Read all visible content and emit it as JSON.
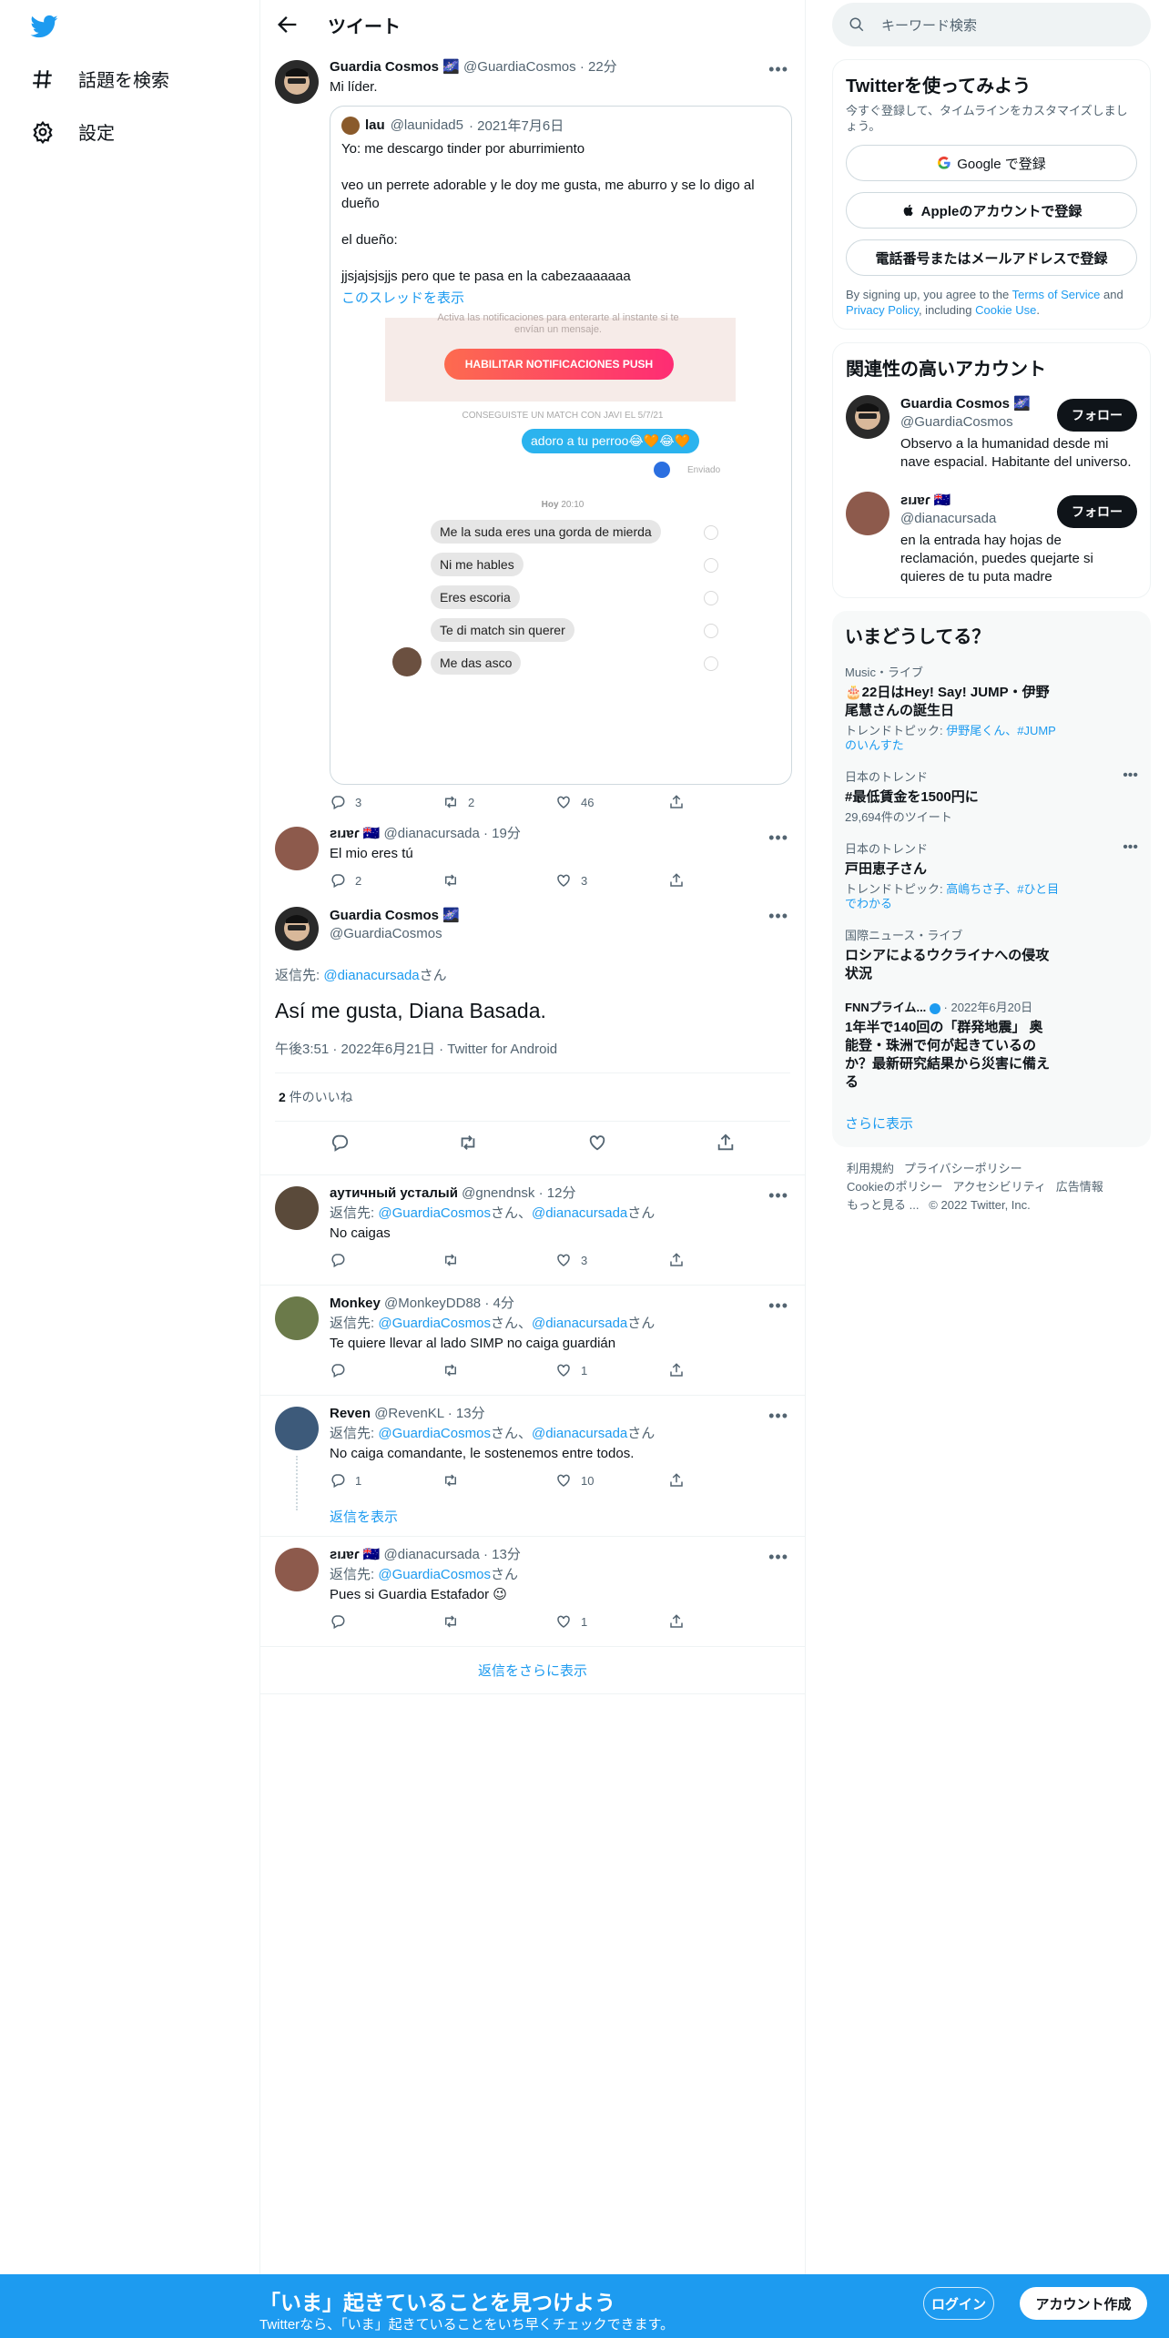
{
  "nav": {
    "explore": "話題を検索",
    "settings": "設定"
  },
  "header": {
    "title": "ツイート"
  },
  "main_tweet": {
    "name": "Guardia Cosmos 🌌",
    "handle": "@GuardiaCosmos",
    "time": "· 22分",
    "text": "Mi líder.",
    "quote": {
      "name": "lau",
      "handle": "@launidad5",
      "date": "· 2021年7月6日",
      "text": "Yo: me descargo tinder por aburrimiento\n\nveo un perrete adorable y le doy me gusta, me aburro y se lo digo al dueño\n\nel dueño:\n\njjsjajsjsjjs pero que te pasa en la cabezaaaaaaa",
      "thread_link": "このスレッドを表示",
      "image": {
        "notif_text": "Activa las notificaciones para enterarte al instante si te envían un mensaje.",
        "notif_button": "HABILITAR NOTIFICACIONES PUSH",
        "match_text": "CONSEGUISTE UN MATCH CON JAVI EL 5/7/21",
        "my_msg": "adoro a tu perroo😂🧡😂🧡",
        "sent": "Enviado",
        "day_label": "Hoy",
        "day_time": "20:10",
        "msgs": [
          "Me la suda eres una gorda de mierda",
          "Ni me hables",
          "Eres escoria",
          "Te di match sin querer",
          "Me das asco"
        ]
      }
    },
    "replies": "3",
    "retweets": "2",
    "likes": "46"
  },
  "reply1": {
    "name": "ƨıɹɐɾ 🇦🇺",
    "handle": "@dianacursada",
    "time": "· 19分",
    "text": "El mio eres tú",
    "replies": "2",
    "retweets": "",
    "likes": "3"
  },
  "focal": {
    "name": "Guardia Cosmos 🌌",
    "handle": "@GuardiaCosmos",
    "reply_to_prefix": "返信先: ",
    "reply_to": "@dianacursada",
    "reply_to_suffix": "さん",
    "text": "Así me gusta, Diana Basada.",
    "meta": "午後3:51 · 2022年6月21日 · Twitter for Android",
    "likes_count": "2",
    "likes_label": " 件のいいね"
  },
  "replies": [
    {
      "name": "аутичный усталый",
      "handle": "@gnendnsk",
      "time": "· 12分",
      "reply_to": [
        "@GuardiaCosmos",
        "@dianacursada"
      ],
      "text": "No caigas",
      "replies": "",
      "retweets": "",
      "likes": "3"
    },
    {
      "name": "Monkey",
      "handle": "@MonkeyDD88",
      "time": "· 4分",
      "reply_to": [
        "@GuardiaCosmos",
        "@dianacursada"
      ],
      "text": "Te quiere llevar al lado SIMP no caiga guardián",
      "replies": "",
      "retweets": "",
      "likes": "1"
    },
    {
      "name": "Reven",
      "handle": "@RevenKL",
      "time": "· 13分",
      "reply_to": [
        "@GuardiaCosmos",
        "@dianacursada"
      ],
      "text": "No caiga comandante, le sostenemos entre todos.",
      "replies": "1",
      "retweets": "",
      "likes": "10",
      "show_replies": "返信を表示"
    },
    {
      "name": "ƨıɹɐɾ 🇦🇺",
      "handle": "@dianacursada",
      "time": "· 13分",
      "reply_to": [
        "@GuardiaCosmos"
      ],
      "text": "Pues si Guardia Estafador 😉",
      "replies": "",
      "retweets": "",
      "likes": "1"
    }
  ],
  "labels": {
    "reply_prefix": "返信先: ",
    "san": "さん",
    "comma": "、",
    "more_replies": "返信をさらに表示"
  },
  "right": {
    "search_placeholder": "キーワード検索",
    "signup": {
      "title": "Twitterを使ってみよう",
      "subtitle": "今すぐ登録して、タイムラインをカスタマイズしましょう。",
      "google": "Google で登録",
      "apple": "Appleのアカウントで登録",
      "phone": "電話番号またはメールアドレスで登録",
      "terms_1": "By signing up, you agree to the ",
      "terms_tos": "Terms of Service",
      "terms_2": " and ",
      "terms_privacy": "Privacy Policy",
      "terms_3": ", including ",
      "terms_cookie": "Cookie Use",
      "terms_4": "."
    },
    "related": {
      "title": "関連性の高いアカウント",
      "follow": "フォロー",
      "accounts": [
        {
          "name": "Guardia Cosmos 🌌",
          "handle": "@GuardiaCosmos",
          "bio": "Observo a la humanidad desde mi nave espacial. Habitante del universo."
        },
        {
          "name": "ƨıɹɐɾ 🇦🇺",
          "handle": "@dianacursada",
          "bio": "en la entrada hay hojas de reclamación, puedes quejarte si quieres de tu puta madre"
        }
      ]
    },
    "trends": {
      "title": "いまどうしてる？",
      "items": [
        {
          "cat": "Music・ライブ",
          "title": "🎂22日はHey! Say! JUMP・伊野尾慧さんの誕生日",
          "meta_prefix": "トレンドトピック: ",
          "meta_links": "伊野尾くん、#JUMPのいんすた",
          "meta": ""
        },
        {
          "cat": "日本のトレンド",
          "title": "#最低賃金を1500円に",
          "meta_prefix": "",
          "meta_links": "",
          "meta": "29,694件のツイート"
        },
        {
          "cat": "日本のトレンド",
          "title": "戸田恵子さん",
          "meta_prefix": "トレンドトピック: ",
          "meta_links": "高嶋ちさ子、#ひと目でわかる",
          "meta": ""
        },
        {
          "cat": "国際ニュース・ライブ",
          "title": "ロシアによるウクライナへの侵攻状況",
          "meta_prefix": "",
          "meta_links": "",
          "meta": ""
        },
        {
          "cat": "FNNプライム...",
          "cat_suffix": "· 2022年6月20日",
          "title": "1年半で140回の「群発地震」 奥能登・珠洲で何が起きているのか？最新研究結果から災害に備える",
          "meta_prefix": "",
          "meta_links": "",
          "meta": ""
        }
      ],
      "show_more": "さらに表示"
    },
    "footer": {
      "line1a": "利用規約",
      "line1b": "プライバシーポリシー",
      "line2a": "Cookieのポリシー",
      "line2b": "アクセシビリティ",
      "line2c": "広告情報",
      "line3a": "もっと見る ...",
      "line3b": "© 2022 Twitter, Inc."
    }
  },
  "bottombar": {
    "title": "「いま」起きていることを見つけよう",
    "subtitle": "Twitterなら、「いま」起きていることをいち早くチェックできます。",
    "login": "ログイン",
    "signup": "アカウント作成"
  },
  "colors": {
    "accent": "#1d9bf0",
    "text": "#0f1419",
    "secondary": "#536471"
  }
}
